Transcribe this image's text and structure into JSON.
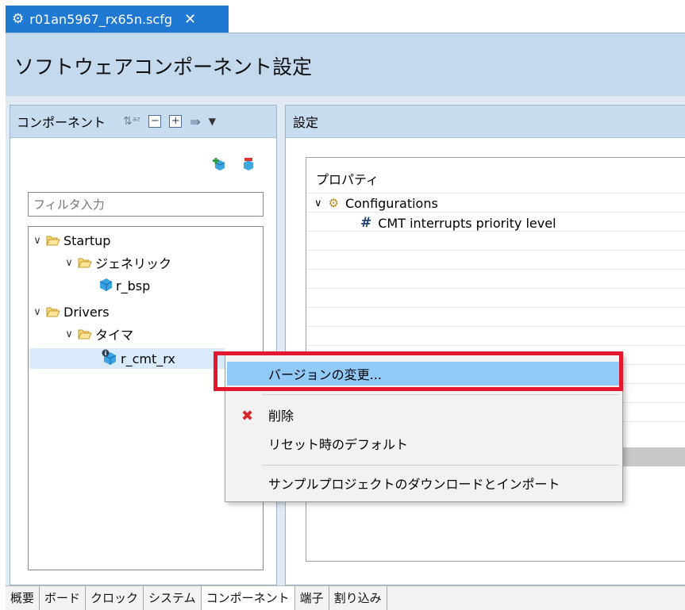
{
  "editor_tab": {
    "title": "r01an5967_rx65n.scfg",
    "close": "✕"
  },
  "header": {
    "title": "ソフトウェアコンポーネント設定"
  },
  "left_panel": {
    "title": "コンポーネント",
    "filter_placeholder": "フィルタ入力",
    "tree": [
      {
        "label": "Startup",
        "level": 0,
        "type": "folder"
      },
      {
        "label": "ジェネリック",
        "level": 1,
        "type": "folder"
      },
      {
        "label": "r_bsp",
        "level": 2,
        "type": "component"
      },
      {
        "label": "Drivers",
        "level": 0,
        "type": "folder"
      },
      {
        "label": "タイマ",
        "level": 1,
        "type": "folder"
      },
      {
        "label": "r_cmt_rx",
        "level": 2,
        "type": "component",
        "selected": true
      }
    ]
  },
  "right_panel": {
    "title": "設定",
    "property_header": "プロパティ",
    "configurations_label": "Configurations",
    "cmt_priority_label": "CMT interrupts priority level"
  },
  "context_menu": {
    "items": [
      {
        "label": "バージョンの変更...",
        "highlighted": true
      },
      {
        "label": "削除",
        "icon": "delete-x-icon"
      },
      {
        "label": "リセット時のデフォルト"
      },
      {
        "label": "サンプルプロジェクトのダウンロードとインポート"
      }
    ]
  },
  "bottom_tabs": [
    "概要",
    "ボード",
    "クロック",
    "システム",
    "コンポーネント",
    "端子",
    "割り込み"
  ],
  "colors": {
    "accent": "#1f78d1",
    "highlight_border": "#e3172d",
    "menu_hover": "#91c9f7"
  }
}
